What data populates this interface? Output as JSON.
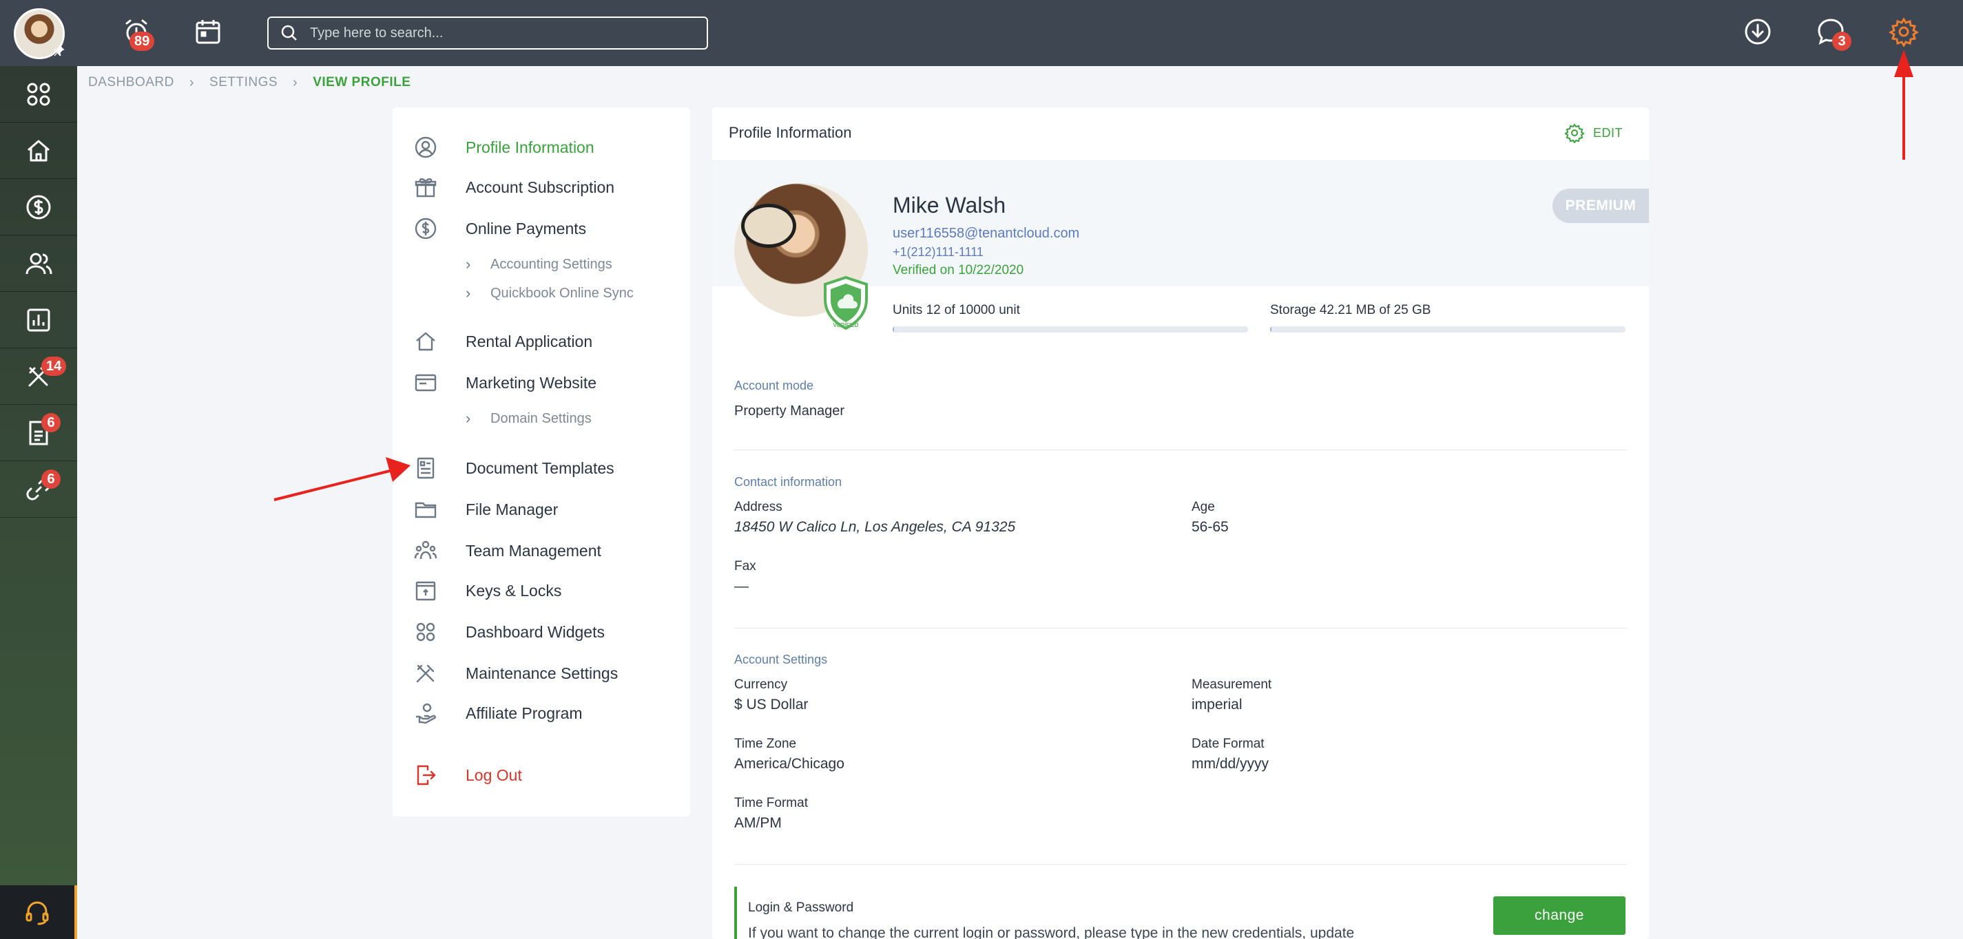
{
  "topbar": {
    "reminders_badge": "89",
    "messages_badge": "3",
    "search_placeholder": "Type here to search..."
  },
  "rail": {
    "maintenance_badge": "14",
    "documents_badge": "6",
    "links_badge": "6"
  },
  "breadcrumb": [
    "DASHBOARD",
    "SETTINGS",
    "VIEW PROFILE"
  ],
  "nav": {
    "profile_information": "Profile Information",
    "account_subscription": "Account Subscription",
    "online_payments": "Online Payments",
    "accounting_settings": "Accounting Settings",
    "quickbook_sync": "Quickbook Online Sync",
    "rental_application": "Rental Application",
    "marketing_website": "Marketing Website",
    "domain_settings": "Domain Settings",
    "document_templates": "Document Templates",
    "file_manager": "File Manager",
    "team_management": "Team Management",
    "keys_locks": "Keys & Locks",
    "dashboard_widgets": "Dashboard Widgets",
    "maintenance_settings": "Maintenance Settings",
    "affiliate_program": "Affiliate Program",
    "log_out": "Log Out"
  },
  "profile": {
    "card_title": "Profile Information",
    "edit_label": "EDIT",
    "name": "Mike Walsh",
    "email": "user116558@tenantcloud.com",
    "phone": "+1(212)111-1111",
    "verified": "Verified on 10/22/2020",
    "plan_badge": "PREMIUM",
    "shield_text": "VERIFIED",
    "units_label": "Units 12 of 10000 unit",
    "units_fraction": 0.0012,
    "storage_label": "Storage 42.21 MB of 25 GB",
    "storage_fraction": 0.0017
  },
  "account_mode": {
    "title": "Account mode",
    "value": "Property Manager"
  },
  "contact": {
    "title": "Contact information",
    "address_label": "Address",
    "address_value": "18450 W Calico Ln, Los Angeles, CA 91325",
    "age_label": "Age",
    "age_value": "56-65",
    "fax_label": "Fax",
    "fax_value": "—"
  },
  "account_settings": {
    "title": "Account Settings",
    "currency_label": "Currency",
    "currency_value": "$ US Dollar",
    "measurement_label": "Measurement",
    "measurement_value": "imperial",
    "timezone_label": "Time Zone",
    "timezone_value": "America/Chicago",
    "date_format_label": "Date Format",
    "date_format_value": "mm/dd/yyyy",
    "time_format_label": "Time Format",
    "time_format_value": "AM/PM"
  },
  "login": {
    "title": "Login & Password",
    "description": "If you want to change the current login or password, please type in the new credentials, update",
    "button": "change"
  },
  "colors": {
    "accent_green": "#3aa13c",
    "badge_red": "#e0453b",
    "settings_orange": "#f07c2e",
    "topbar": "#3d4651"
  }
}
